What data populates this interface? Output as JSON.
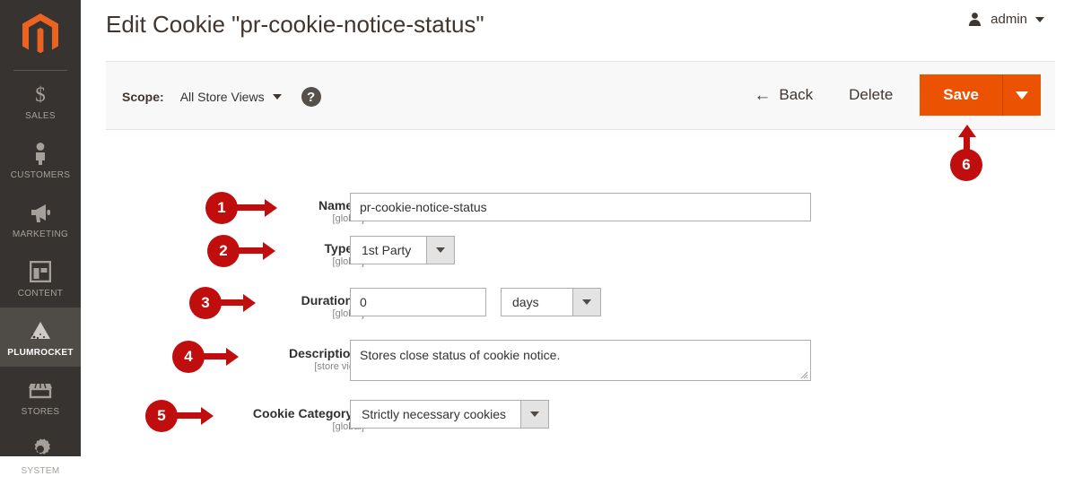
{
  "sidebar": {
    "logo": "magento-logo",
    "items": [
      {
        "label": "SALES",
        "icon": "dollar-icon",
        "active": false
      },
      {
        "label": "CUSTOMERS",
        "icon": "person-icon",
        "active": false
      },
      {
        "label": "MARKETING",
        "icon": "megaphone-icon",
        "active": false
      },
      {
        "label": "CONTENT",
        "icon": "layout-icon",
        "active": false
      },
      {
        "label": "PLUMROCKET",
        "icon": "plumrocket-icon",
        "active": true
      },
      {
        "label": "STORES",
        "icon": "store-icon",
        "active": false
      },
      {
        "label": "SYSTEM",
        "icon": "gear-icon",
        "active": false
      }
    ]
  },
  "header": {
    "title": "Edit Cookie \"pr-cookie-notice-status\"",
    "admin_user": "admin"
  },
  "toolbar": {
    "scope_label": "Scope:",
    "scope_value": "All Store Views",
    "help_icon": "?",
    "back_label": "Back",
    "back_icon": "←",
    "delete_label": "Delete",
    "save_label": "Save"
  },
  "form": {
    "fields": [
      {
        "label": "Name",
        "scope": "[global]",
        "required": "*",
        "value": "pr-cookie-notice-status",
        "callout": "1"
      },
      {
        "label": "Type",
        "scope": "[global]",
        "required": "*",
        "value": "1st Party",
        "callout": "2"
      },
      {
        "label": "Duration",
        "scope": "[global]",
        "required": "*",
        "value": "0",
        "unit_value": "days",
        "callout": "3"
      },
      {
        "label": "Description",
        "scope": "[store view]",
        "required": "",
        "value": "Stores close status of cookie notice.",
        "callout": "4"
      },
      {
        "label": "Cookie Category",
        "scope": "[global]",
        "required": "*",
        "value": "Strictly necessary cookies",
        "callout": "5"
      }
    ],
    "save_callout": "6"
  },
  "colors": {
    "accent": "#eb5202",
    "sidebar": "#373330",
    "callout": "#c00d0d",
    "required": "#e22626"
  }
}
